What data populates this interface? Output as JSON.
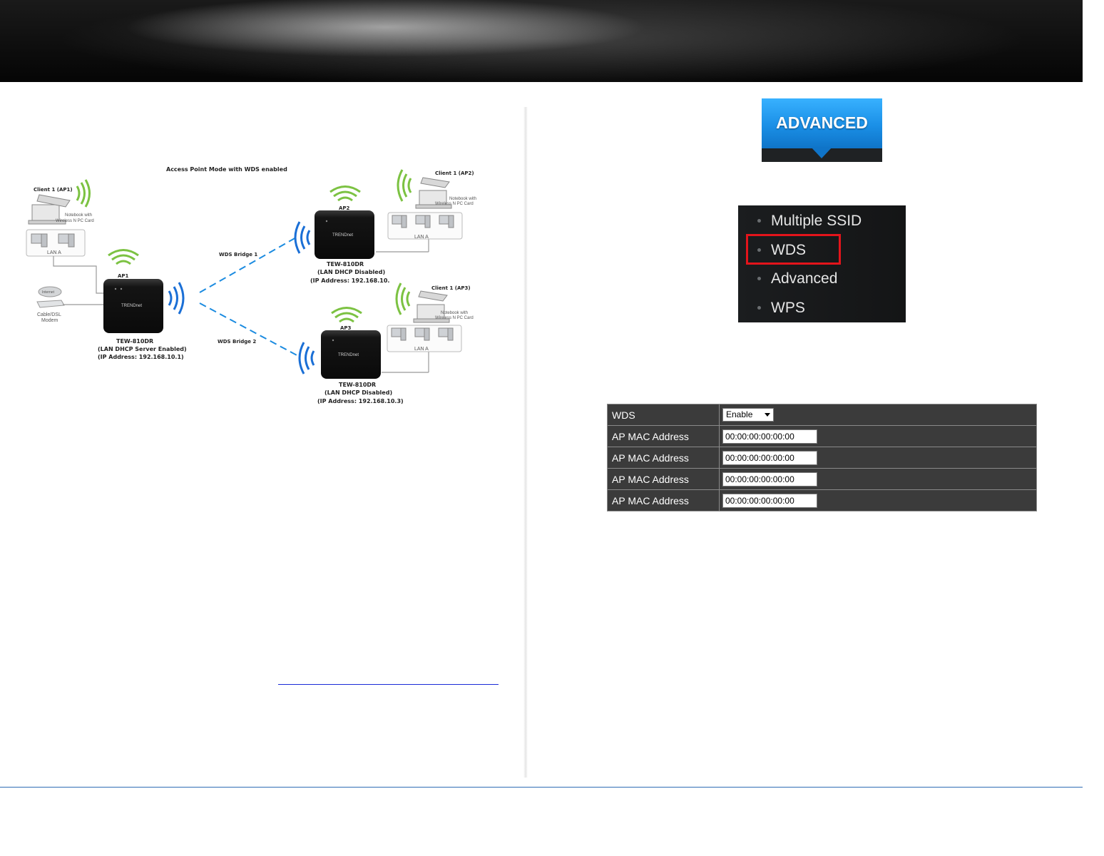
{
  "diagram": {
    "title": "Access Point Mode with WDS enabled",
    "client_ap1": "Client 1 (AP1)",
    "client_ap2": "Client 1 (AP2)",
    "client_ap3": "Client 1 (AP3)",
    "notebook_line1": "Notebook with",
    "notebook_line2": "Wireless N PC Card",
    "lan_label": "LAN A",
    "internet_label": "Internet",
    "modem_line1": "Cable/DSL",
    "modem_line2": "Modem",
    "ap1_label": "AP1",
    "ap2_label": "AP2",
    "ap3_label": "AP3",
    "brand": "TRENDnet",
    "bridge1": "WDS Bridge 1",
    "bridge2": "WDS Bridge 2",
    "main_model": "TEW-810DR",
    "main_mode": "(LAN DHCP Server Enabled)",
    "main_ip": "(IP Address: 192.168.10.1)",
    "ap2_model": "TEW-810DR",
    "ap2_mode": "(LAN DHCP Disabled)",
    "ap2_ip": "(IP Address: 192.168.10.",
    "ap3_model": "TEW-810DR",
    "ap3_mode": "(LAN DHCP Disabled)",
    "ap3_ip": "(IP Address: 192.168.10.3)"
  },
  "advanced_button": {
    "label": "ADVANCED"
  },
  "menu": {
    "items": [
      {
        "label": "Multiple SSID"
      },
      {
        "label": "WDS"
      },
      {
        "label": "Advanced"
      },
      {
        "label": "WPS"
      }
    ],
    "highlighted": "WDS"
  },
  "wds_table": {
    "rows": [
      {
        "label": "WDS",
        "value": "Enable",
        "kind": "select"
      },
      {
        "label": "AP MAC Address",
        "value": "00:00:00:00:00:00",
        "kind": "input"
      },
      {
        "label": "AP MAC Address",
        "value": "00:00:00:00:00:00",
        "kind": "input"
      },
      {
        "label": "AP MAC Address",
        "value": "00:00:00:00:00:00",
        "kind": "input"
      },
      {
        "label": "AP MAC Address",
        "value": "00:00:00:00:00:00",
        "kind": "input"
      }
    ]
  },
  "colors": {
    "header_dark": "#050505",
    "accent_blue": "#1a8fe6",
    "highlight_red": "#e3141b",
    "table_bg": "#3b3b3b",
    "footer_line": "#2f6db5",
    "wifi_green": "#7cc242"
  }
}
